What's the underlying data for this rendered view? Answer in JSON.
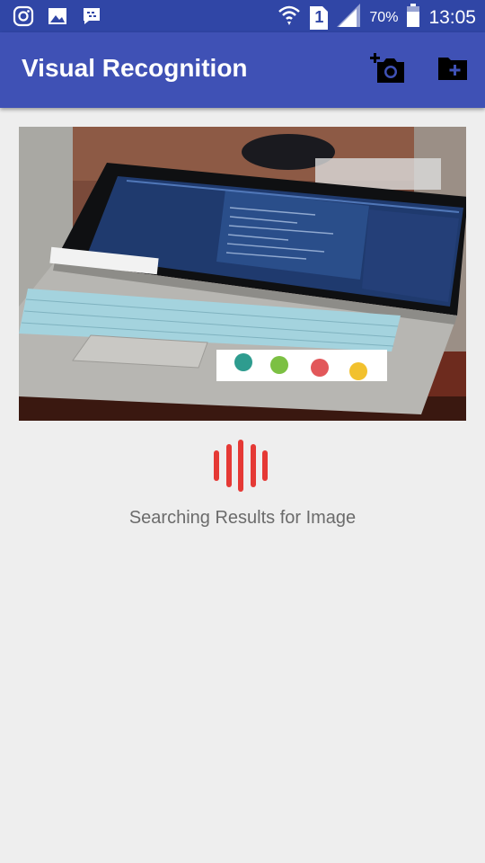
{
  "status_bar": {
    "battery_percent": "70%",
    "time": "13:05",
    "sim_slot": "1",
    "icons": [
      "instagram-icon",
      "gallery-icon",
      "bbm-icon",
      "wifi-icon",
      "sim-icon",
      "signal-icon",
      "battery-icon"
    ]
  },
  "app_bar": {
    "title": "Visual Recognition",
    "actions": [
      "add-camera-icon",
      "add-folder-icon"
    ],
    "color": "#3f51b5"
  },
  "main": {
    "image_subject": "laptop photo",
    "status_text": "Searching Results for Image",
    "loader_color": "#e53935"
  }
}
